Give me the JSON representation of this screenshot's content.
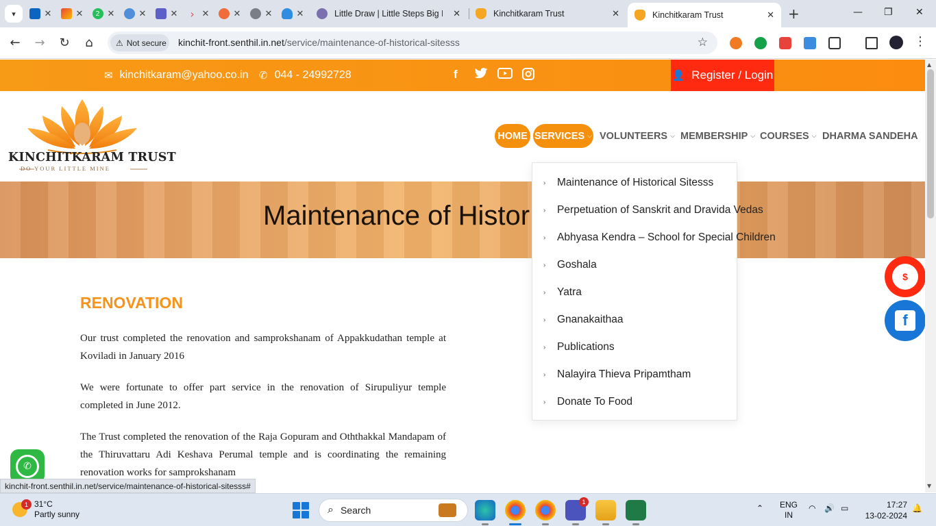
{
  "browser": {
    "tabs": [
      {
        "title": "Little Draw | Little Steps Big D"
      },
      {
        "title": "Kinchitkaram Trust"
      },
      {
        "title": "Kinchitkaram Trust",
        "active": true
      }
    ],
    "security_label": "Not secure",
    "url_host": "kinchit-front.senthil.in.net",
    "url_path": "/service/maintenance-of-historical-sitesss",
    "status_link": "kinchit-front.senthil.in.net/service/maintenance-of-historical-sitesss#",
    "mini_tab_badge": "2"
  },
  "topbar": {
    "email": "kinchitkaram@yahoo.co.in",
    "phone": "044 - 24992728",
    "register_label": "Register / Login"
  },
  "logo": {
    "name": "KINCHITKARAM TRUST",
    "tagline": "DO YOUR LITTLE MINE"
  },
  "nav": {
    "home": "HOME",
    "services": "SERVICES",
    "volunteers": "VOLUNTEERS",
    "membership": "MEMBERSHIP",
    "courses": "COURSES",
    "dharma": "DHARMA SANDEHA"
  },
  "banner": {
    "title": "Maintenance of Histor"
  },
  "dropdown": {
    "items": [
      "Maintenance of Historical Sitesss",
      "Perpetuation of Sanskrit and Dravida Vedas",
      "Abhyasa Kendra – School for Special Children",
      "Goshala",
      "Yatra",
      "Gnanakaithaa",
      "Publications",
      "Nalayira Thieva Pripamtham",
      "Donate To Food"
    ]
  },
  "content": {
    "section_title": "RENOVATION",
    "paragraphs": [
      "Our trust completed the renovation and samprokshanam of Appakkudathan temple at Koviladi in January 2016",
      "We were fortunate to offer part service in the renovation of Sirupuliyur temple completed in June 2012.",
      "The Trust completed the renovation of the Raja Gopuram and Oththakkal Mandapam of the Thiruvattaru Adi Keshava Perumal temple and is coordinating the remaining renovation works for samprokshanam"
    ]
  },
  "taskbar": {
    "weather_temp": "31°C",
    "weather_desc": "Partly sunny",
    "weather_badge": "1",
    "search_label": "Search",
    "lang_line1": "ENG",
    "lang_line2": "IN",
    "time": "17:27",
    "date": "13-02-2024",
    "teams_badge": "1"
  },
  "colors": {
    "accent_orange": "#f7921a",
    "register_red": "#ff2a10",
    "whatsapp_green": "#2fb843",
    "facebook_blue": "#1877d6"
  }
}
